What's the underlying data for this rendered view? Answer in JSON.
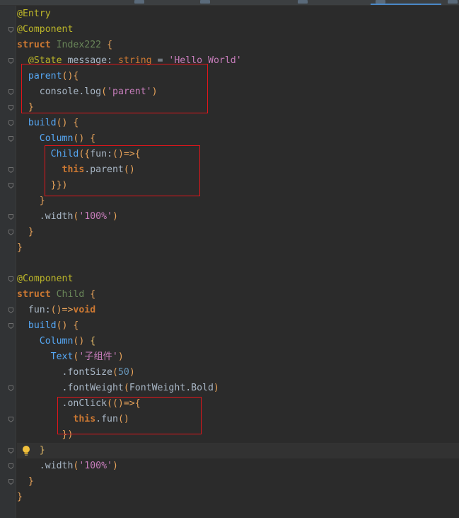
{
  "lines": [
    {
      "tokens": [
        {
          "t": "@Entry",
          "c": "t-anno"
        }
      ]
    },
    {
      "tokens": [
        {
          "t": "@Component",
          "c": "t-anno"
        }
      ]
    },
    {
      "tokens": [
        {
          "t": "struct",
          "c": "t-kw"
        },
        {
          "t": " ",
          "c": "t-pl"
        },
        {
          "t": "Index222",
          "c": "t-cls"
        },
        {
          "t": " {",
          "c": "t-paren"
        }
      ]
    },
    {
      "tokens": [
        {
          "t": "  ",
          "c": "t-pl"
        },
        {
          "t": "@State",
          "c": "t-anno"
        },
        {
          "t": " message",
          "c": "t-pl"
        },
        {
          "t": ": ",
          "c": "t-pl"
        },
        {
          "t": "string",
          "c": "t-type"
        },
        {
          "t": " = ",
          "c": "t-pl"
        },
        {
          "t": "'Hello World'",
          "c": "t-str2"
        }
      ]
    },
    {
      "tokens": [
        {
          "t": "  ",
          "c": "t-pl"
        },
        {
          "t": "parent",
          "c": "t-comp"
        },
        {
          "t": "(){",
          "c": "t-paren"
        }
      ]
    },
    {
      "tokens": [
        {
          "t": "    console",
          "c": "t-pl"
        },
        {
          "t": ".",
          "c": "t-pl"
        },
        {
          "t": "log",
          "c": "t-pl"
        },
        {
          "t": "(",
          "c": "t-paren"
        },
        {
          "t": "'parent'",
          "c": "t-str2"
        },
        {
          "t": ")",
          "c": "t-paren"
        }
      ]
    },
    {
      "tokens": [
        {
          "t": "  ",
          "c": "t-pl"
        },
        {
          "t": "}",
          "c": "t-paren"
        }
      ]
    },
    {
      "tokens": [
        {
          "t": "  ",
          "c": "t-pl"
        },
        {
          "t": "build",
          "c": "t-comp"
        },
        {
          "t": "() {",
          "c": "t-paren"
        }
      ]
    },
    {
      "tokens": [
        {
          "t": "    ",
          "c": "t-pl"
        },
        {
          "t": "Column",
          "c": "t-comp"
        },
        {
          "t": "() {",
          "c": "t-paren"
        }
      ]
    },
    {
      "tokens": [
        {
          "t": "      ",
          "c": "t-pl"
        },
        {
          "t": "Child",
          "c": "t-comp"
        },
        {
          "t": "({",
          "c": "t-paren"
        },
        {
          "t": "fun",
          "c": "t-pl"
        },
        {
          "t": ":",
          "c": "t-pl"
        },
        {
          "t": "()=>{",
          "c": "t-paren"
        }
      ]
    },
    {
      "tokens": [
        {
          "t": "        ",
          "c": "t-pl"
        },
        {
          "t": "this",
          "c": "t-this"
        },
        {
          "t": ".parent",
          "c": "t-pl"
        },
        {
          "t": "()",
          "c": "t-paren"
        }
      ]
    },
    {
      "tokens": [
        {
          "t": "      ",
          "c": "t-pl"
        },
        {
          "t": "}})",
          "c": "t-paren"
        }
      ]
    },
    {
      "tokens": [
        {
          "t": "    ",
          "c": "t-pl"
        },
        {
          "t": "}",
          "c": "t-paren"
        }
      ]
    },
    {
      "tokens": [
        {
          "t": "    .width",
          "c": "t-pl"
        },
        {
          "t": "(",
          "c": "t-paren"
        },
        {
          "t": "'100%'",
          "c": "t-str2"
        },
        {
          "t": ")",
          "c": "t-paren"
        }
      ]
    },
    {
      "tokens": [
        {
          "t": "  ",
          "c": "t-pl"
        },
        {
          "t": "}",
          "c": "t-paren"
        }
      ]
    },
    {
      "tokens": [
        {
          "t": "}",
          "c": "t-paren"
        }
      ]
    },
    {
      "tokens": []
    },
    {
      "tokens": [
        {
          "t": "@Component",
          "c": "t-anno"
        }
      ]
    },
    {
      "tokens": [
        {
          "t": "struct",
          "c": "t-kw"
        },
        {
          "t": " ",
          "c": "t-pl"
        },
        {
          "t": "Child",
          "c": "t-cls"
        },
        {
          "t": " {",
          "c": "t-paren"
        }
      ]
    },
    {
      "tokens": [
        {
          "t": "  fun",
          "c": "t-pl"
        },
        {
          "t": ":",
          "c": "t-pl"
        },
        {
          "t": "()=>",
          "c": "t-paren"
        },
        {
          "t": "void",
          "c": "t-kw"
        }
      ]
    },
    {
      "tokens": [
        {
          "t": "  ",
          "c": "t-pl"
        },
        {
          "t": "build",
          "c": "t-comp"
        },
        {
          "t": "() {",
          "c": "t-paren"
        }
      ]
    },
    {
      "tokens": [
        {
          "t": "    ",
          "c": "t-pl"
        },
        {
          "t": "Column",
          "c": "t-comp"
        },
        {
          "t": "() ",
          "c": "t-paren"
        },
        {
          "t": "{",
          "c": "t-brace"
        }
      ]
    },
    {
      "tokens": [
        {
          "t": "      ",
          "c": "t-pl"
        },
        {
          "t": "Text",
          "c": "t-comp"
        },
        {
          "t": "(",
          "c": "t-paren"
        },
        {
          "t": "'子组件'",
          "c": "t-str2"
        },
        {
          "t": ")",
          "c": "t-paren"
        }
      ]
    },
    {
      "tokens": [
        {
          "t": "        .fontSize",
          "c": "t-pl"
        },
        {
          "t": "(",
          "c": "t-paren"
        },
        {
          "t": "50",
          "c": "t-num"
        },
        {
          "t": ")",
          "c": "t-paren"
        }
      ]
    },
    {
      "tokens": [
        {
          "t": "        .fontWeight",
          "c": "t-pl"
        },
        {
          "t": "(",
          "c": "t-paren"
        },
        {
          "t": "FontWeight.Bold",
          "c": "t-pl"
        },
        {
          "t": ")",
          "c": "t-paren"
        }
      ]
    },
    {
      "tokens": [
        {
          "t": "        .onClick",
          "c": "t-pl"
        },
        {
          "t": "(()=>{",
          "c": "t-paren"
        }
      ]
    },
    {
      "tokens": [
        {
          "t": "          ",
          "c": "t-pl"
        },
        {
          "t": "this",
          "c": "t-this"
        },
        {
          "t": ".fun",
          "c": "t-pl"
        },
        {
          "t": "()",
          "c": "t-paren"
        }
      ]
    },
    {
      "tokens": [
        {
          "t": "        ",
          "c": "t-pl"
        },
        {
          "t": "})",
          "c": "t-paren"
        }
      ]
    },
    {
      "tokens": [
        {
          "t": "    ",
          "c": "t-pl"
        },
        {
          "t": "}",
          "c": "t-brace"
        }
      ],
      "current": true,
      "bulb": true
    },
    {
      "tokens": [
        {
          "t": "    .width",
          "c": "t-pl"
        },
        {
          "t": "(",
          "c": "t-paren"
        },
        {
          "t": "'100%'",
          "c": "t-str2"
        },
        {
          "t": ")",
          "c": "t-paren"
        }
      ]
    },
    {
      "tokens": [
        {
          "t": "  ",
          "c": "t-pl"
        },
        {
          "t": "}",
          "c": "t-paren"
        }
      ]
    },
    {
      "tokens": [
        {
          "t": "}",
          "c": "t-paren"
        }
      ]
    }
  ],
  "folds": [
    2,
    4,
    6,
    7,
    8,
    9,
    11,
    12,
    14,
    15,
    18,
    20,
    21,
    25,
    27,
    29,
    30,
    31
  ],
  "colors": {
    "background": "#2b2b2b",
    "gutter": "#313335",
    "highlight_box": "#e0161b",
    "annotation": "#bbb529",
    "keyword": "#cc7832",
    "string": "#c77dbb",
    "number": "#6897bb",
    "component": "#56a8f5"
  },
  "icons": [
    "fold-marker-icon",
    "lightbulb-icon"
  ]
}
